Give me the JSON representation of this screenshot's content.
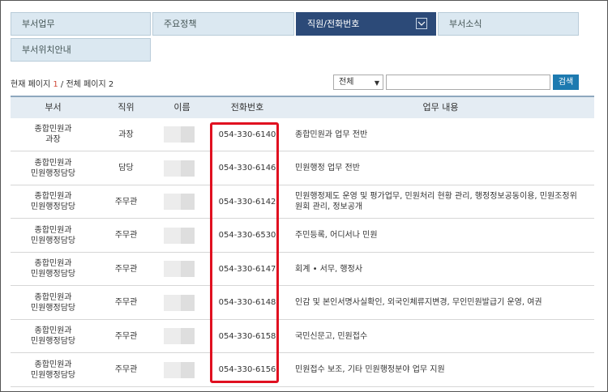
{
  "tabs": [
    {
      "label": "부서업무"
    },
    {
      "label": "주요정책"
    },
    {
      "label": "직원/전화번호"
    },
    {
      "label": "부서소식"
    },
    {
      "label": "부서위치안내"
    }
  ],
  "pagination": {
    "current_prefix": "현재 페이지",
    "current": "1",
    "separator": " / ",
    "total_label": "전체 페이지 2"
  },
  "search": {
    "select_value": "전체",
    "input_value": "",
    "button_label": "검색"
  },
  "table": {
    "headers": [
      "부서",
      "직위",
      "이름",
      "전화번호",
      "업무 내용"
    ],
    "rows": [
      {
        "dept_line1": "종합민원과",
        "dept_line2": "과장",
        "position": "과장",
        "phone": "054-330-6140",
        "duty1": "종합민원과 업무 전반",
        "duty2": ""
      },
      {
        "dept_line1": "종합민원과",
        "dept_line2": "민원행정담당",
        "position": "담당",
        "phone": "054-330-6146",
        "duty1": "민원행정 업무 전반",
        "duty2": ""
      },
      {
        "dept_line1": "종합민원과",
        "dept_line2": "민원행정담당",
        "position": "주무관",
        "phone": "054-330-6142",
        "duty1": "민원행정제도 운영 및 평가업무, 민원처리 현황 관리, 행정정보공동이용, 민원조정위",
        "duty2": "원회 관리, 정보공개"
      },
      {
        "dept_line1": "종합민원과",
        "dept_line2": "민원행정담당",
        "position": "주무관",
        "phone": "054-330-6530",
        "duty1": "주민등록, 어디서나 민원",
        "duty2": ""
      },
      {
        "dept_line1": "종합민원과",
        "dept_line2": "민원행정담당",
        "position": "주무관",
        "phone": "054-330-6147",
        "duty1": "회계 • 서무, 행정사",
        "duty2": ""
      },
      {
        "dept_line1": "종합민원과",
        "dept_line2": "민원행정담당",
        "position": "주무관",
        "phone": "054-330-6148",
        "duty1": "인감 및 본인서명사실확인, 외국인체류지변경, 무인민원발급기 운영, 여권",
        "duty2": ""
      },
      {
        "dept_line1": "종합민원과",
        "dept_line2": "민원행정담당",
        "position": "주무관",
        "phone": "054-330-6158",
        "duty1": "국민신문고, 민원접수",
        "duty2": ""
      },
      {
        "dept_line1": "종합민원과",
        "dept_line2": "민원행정담당",
        "position": "주무관",
        "phone": "054-330-6156",
        "duty1": "민원접수 보조, 기타 민원행정분야 업무 지원",
        "duty2": ""
      }
    ]
  },
  "colors": {
    "tab_bg": "#dbe8f1",
    "tab_active_bg": "#2c4a78",
    "search_button": "#1d7ab0",
    "highlight_border": "#e01020"
  }
}
